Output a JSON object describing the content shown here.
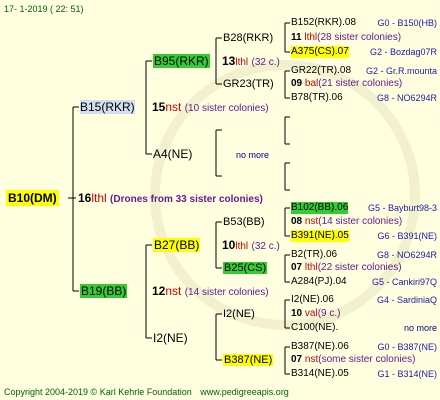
{
  "header": {
    "date": "17-  1-2019 ( 22: 51)"
  },
  "root": {
    "id": "B10(DM)",
    "num": "16",
    "unit": "lthl",
    "note": "(Drones from 33 sister colonies)"
  },
  "gen1": [
    {
      "id": "B15(RKR)",
      "num": "15",
      "unit": "nst",
      "note": "(10 sister colonies)"
    },
    {
      "id": "B19(BB)",
      "num": "12",
      "unit": "nst",
      "note": "(14 sister colonies)"
    }
  ],
  "gen2": [
    {
      "id": "B95(RKR)",
      "num": "13",
      "unit": "lthl",
      "note": "(32 c.)"
    },
    {
      "id": "A4(NE)",
      "extra": "no more"
    },
    {
      "id": "B27(BB)",
      "num": "10",
      "unit": "lthl",
      "note": "(32 c.)"
    },
    {
      "id": "I2(NE)",
      "num": "",
      "unit": "",
      "note": ""
    }
  ],
  "gen3": [
    {
      "id": "B28(RKR)",
      "num": "11",
      "unit": "lthl",
      "note": "(28 sister colonies)"
    },
    {
      "id": "GR23(TR)",
      "num": "09",
      "unit": "bal",
      "note": "(21 sister colonies)"
    },
    {
      "id": "B53(BB)",
      "num": "08",
      "unit": "nst",
      "note": "(14 sister colonies)"
    },
    {
      "id": "B25(CS)",
      "num": "07",
      "unit": "lthl",
      "note": "(22 sister colonies)"
    },
    {
      "id": "I2(NE)",
      "num": "10",
      "unit": "val",
      "note": "(9 c.)"
    },
    {
      "id": "B387(NE)",
      "num": "07",
      "unit": "nst",
      "note": "(some sister colonies)"
    }
  ],
  "gen4": [
    {
      "id": "B152(RKR).08",
      "info": "G0 - B150(HB)"
    },
    {
      "id": "A375(CS).07",
      "info": "G2 - Bozdag07R"
    },
    {
      "id": "GR22(TR).08",
      "info": "G2 - Gr.R.mounta"
    },
    {
      "id": "B78(TR).06",
      "info": "G8 - NO6294R"
    },
    {
      "id": "B102(BB).06",
      "info": "G5 - Bayburt98-3"
    },
    {
      "id": "B391(NE).05",
      "info": "G6 - B391(NE)"
    },
    {
      "id": "B2(TR).06",
      "info": "G8 - NO6294R"
    },
    {
      "id": "A284(PJ).04",
      "info": "G5 - Cankiri97Q"
    },
    {
      "id": "I2(NE).06",
      "info": "G4 - SardiniaQ"
    },
    {
      "id": "C100(NE).",
      "info": "no more"
    },
    {
      "id": "B387(NE).06",
      "info": "G0 - B387(NE)"
    },
    {
      "id": "B314(NE).05",
      "info": "G1 - B314(NE)"
    }
  ],
  "footer": {
    "copyright": "Copyright 2004-2019 © Karl Kehrle Foundation",
    "site": "www.pedigreeapis.org"
  },
  "colors": {
    "bg": "#ffffe0",
    "highlight_yellow": "#ffff00",
    "highlight_green": "#33cc33",
    "red": "#cc0000",
    "blue": "#1a1aaa"
  }
}
